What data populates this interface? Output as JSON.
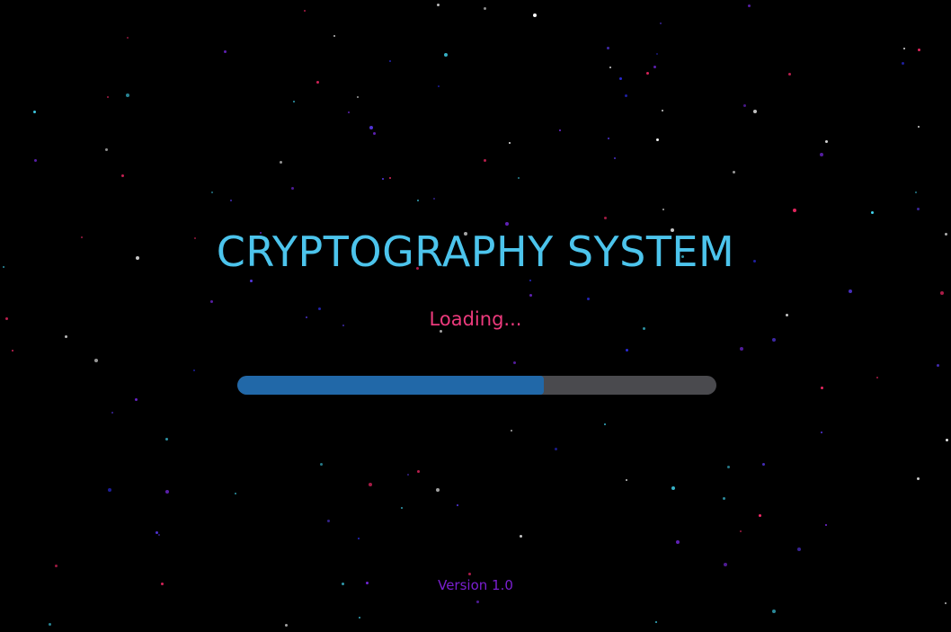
{
  "app": {
    "title": "CRYPTOGRAPHY SYSTEM",
    "status": "Loading...",
    "version": "Version 1.0"
  },
  "progress": {
    "fraction": 0.64
  },
  "colors": {
    "background": "#000000",
    "title": "#4cc4ec",
    "status": "#ec3a7c",
    "version": "#7a1fd0",
    "progress_fill": "#2168a8",
    "progress_track": "#4a4a4e"
  },
  "stars": {
    "palette": [
      "#2a2ad8",
      "#7a2ae8",
      "#ff2a6a",
      "#42d6f0",
      "#5a3af0",
      "#ffffff"
    ]
  }
}
